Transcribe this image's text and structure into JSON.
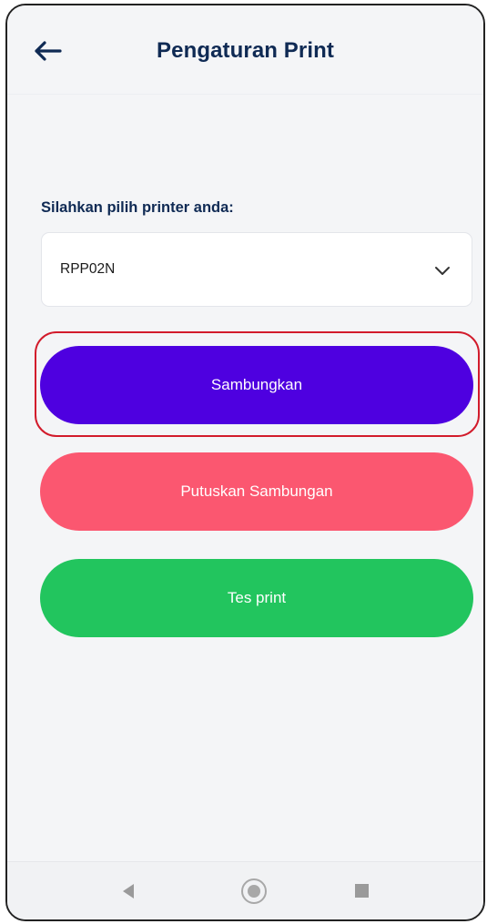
{
  "header": {
    "back_icon": "arrow-left-icon",
    "title": "Pengaturan Print"
  },
  "printer": {
    "prompt": "Silahkan pilih printer anda:",
    "selected": "RPP02N",
    "dropdown_icon": "chevron-down-icon"
  },
  "actions": {
    "connect_label": "Sambungkan",
    "disconnect_label": "Putuskan Sambungan",
    "test_label": "Tes print"
  },
  "colors": {
    "title": "#0f2a54",
    "connect": "#4e00e0",
    "disconnect": "#fb5770",
    "test": "#22c55e",
    "highlight": "#d21b2b"
  },
  "nav": {
    "back_icon": "triangle-back-icon",
    "home_icon": "circle-home-icon",
    "recent_icon": "square-recent-icon"
  }
}
